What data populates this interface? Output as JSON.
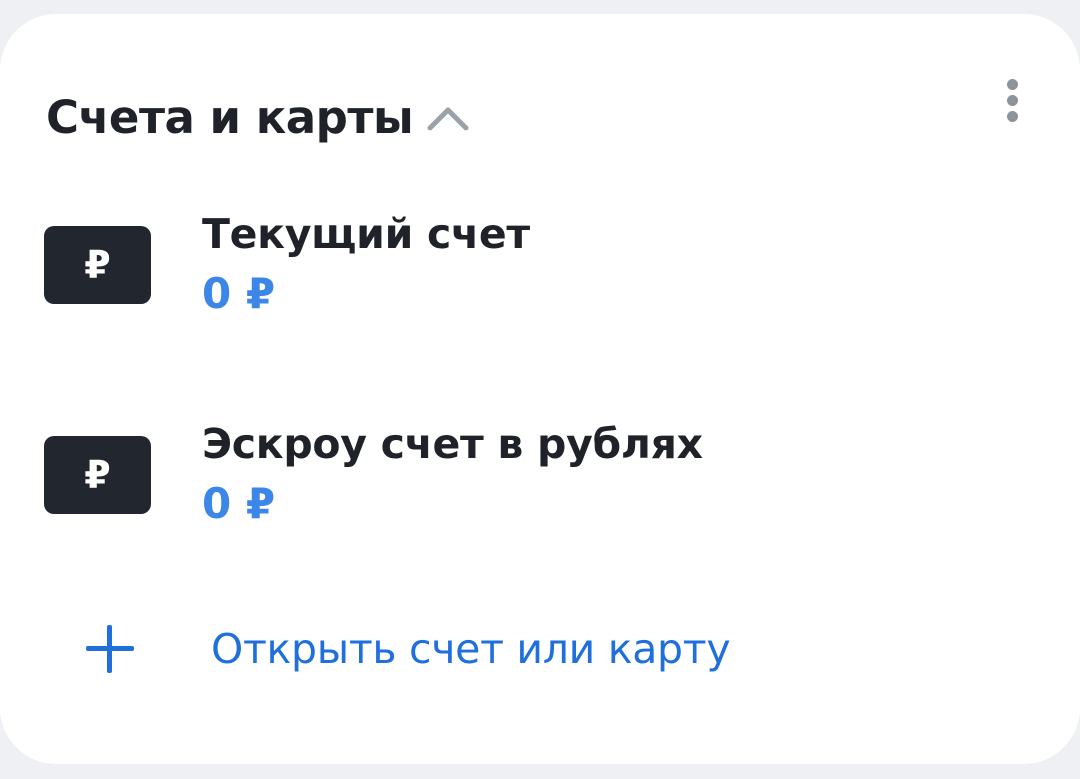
{
  "header": {
    "title": "Счета и карты",
    "collapse_icon": "chevron-up-icon",
    "menu_icon": "more-vertical-icon"
  },
  "accounts": [
    {
      "icon_symbol": "₽",
      "name": "Текущий счет",
      "balance": "0 ₽"
    },
    {
      "icon_symbol": "₽",
      "name": "Эскроу счет в рублях",
      "balance": "0 ₽"
    }
  ],
  "actions": {
    "open_account_label": "Открыть счет или карту",
    "open_account_icon": "plus-icon"
  },
  "colors": {
    "background": "#eef0f3",
    "card": "#ffffff",
    "text_primary": "#1f2329",
    "amount_blue": "#3b86e6",
    "link_blue": "#1f6fdc",
    "badge_dark": "#22272f",
    "icon_gray": "#8d939c"
  }
}
